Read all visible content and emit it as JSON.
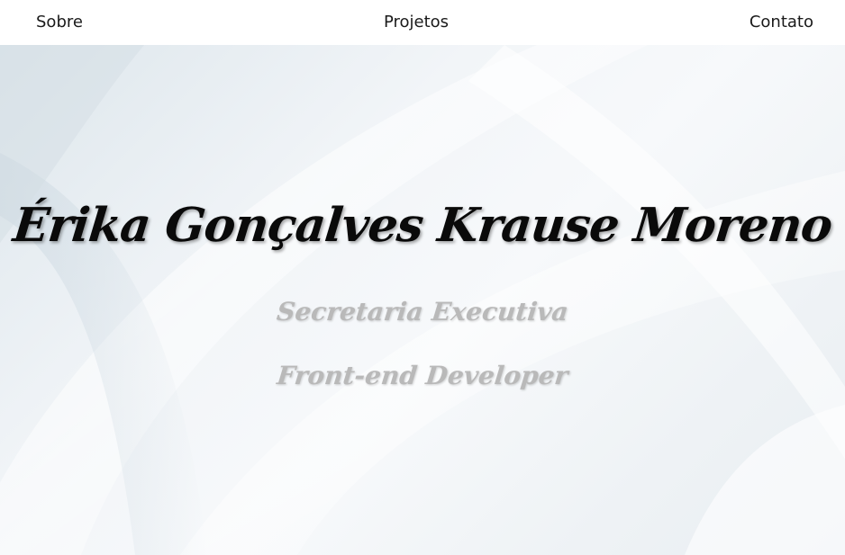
{
  "nav": {
    "sobre": "Sobre",
    "projetos": "Projetos",
    "contato": "Contato"
  },
  "hero": {
    "name": "Érika Gonçalves Krause Moreno",
    "roles": [
      "Secretaria Executiva",
      "Front-end Developer"
    ]
  },
  "colors": {
    "nav_background": "#ffffff",
    "nav_text": "#1a1a1a",
    "name_text": "#0a0a0a",
    "role_text": "#b9b9b9",
    "hero_background": "#eef2f5"
  }
}
